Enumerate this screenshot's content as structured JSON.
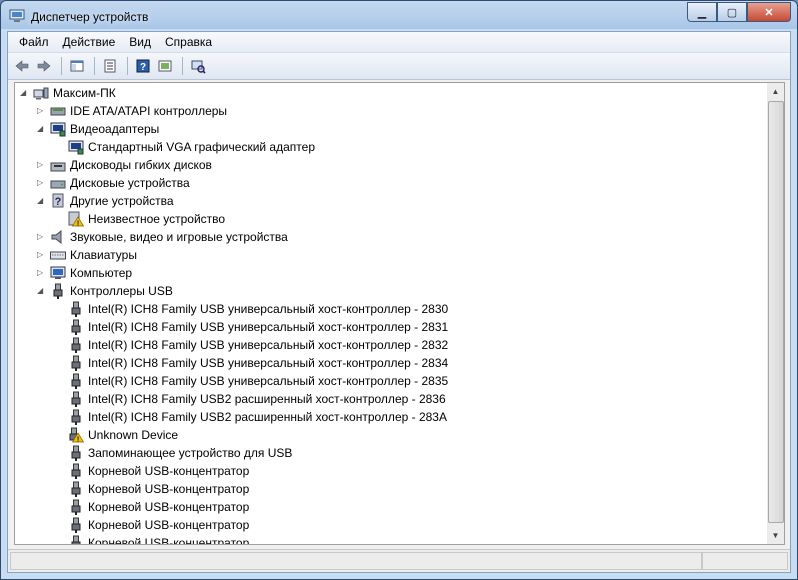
{
  "window": {
    "title": "Диспетчер устройств",
    "caption": {
      "minimize": "▁",
      "maximize": "▢",
      "close": "✕"
    }
  },
  "menu": [
    "Файл",
    "Действие",
    "Вид",
    "Справка"
  ],
  "toolbar": [
    "back-arrow-icon",
    "forward-arrow-icon",
    "sep",
    "console-tree-icon",
    "sep",
    "properties-icon",
    "sep",
    "help-icon",
    "show-hide-icon",
    "sep",
    "scan-hardware-icon"
  ],
  "tree": [
    {
      "label": "Максим-ПК",
      "level": 0,
      "expander": "open",
      "icon": "computer"
    },
    {
      "label": "IDE ATA/ATAPI контроллеры",
      "level": 1,
      "expander": "closed",
      "icon": "ide"
    },
    {
      "label": "Видеоадаптеры",
      "level": 1,
      "expander": "open",
      "icon": "display"
    },
    {
      "label": "Стандартный VGA графический адаптер",
      "level": 2,
      "expander": "none",
      "icon": "display"
    },
    {
      "label": "Дисководы гибких дисков",
      "level": 1,
      "expander": "closed",
      "icon": "floppy"
    },
    {
      "label": "Дисковые устройства",
      "level": 1,
      "expander": "closed",
      "icon": "disk"
    },
    {
      "label": "Другие устройства",
      "level": 1,
      "expander": "open",
      "icon": "unknown"
    },
    {
      "label": "Неизвестное устройство",
      "level": 2,
      "expander": "none",
      "icon": "warning"
    },
    {
      "label": "Звуковые, видео и игровые устройства",
      "level": 1,
      "expander": "closed",
      "icon": "sound"
    },
    {
      "label": "Клавиатуры",
      "level": 1,
      "expander": "closed",
      "icon": "keyboard"
    },
    {
      "label": "Компьютер",
      "level": 1,
      "expander": "closed",
      "icon": "monitor"
    },
    {
      "label": "Контроллеры USB",
      "level": 1,
      "expander": "open",
      "icon": "usb"
    },
    {
      "label": "Intel(R) ICH8 Family USB универсальный хост-контроллер  - 2830",
      "level": 2,
      "expander": "none",
      "icon": "usb"
    },
    {
      "label": "Intel(R) ICH8 Family USB универсальный хост-контроллер  - 2831",
      "level": 2,
      "expander": "none",
      "icon": "usb"
    },
    {
      "label": "Intel(R) ICH8 Family USB универсальный хост-контроллер  - 2832",
      "level": 2,
      "expander": "none",
      "icon": "usb"
    },
    {
      "label": "Intel(R) ICH8 Family USB универсальный хост-контроллер  - 2834",
      "level": 2,
      "expander": "none",
      "icon": "usb"
    },
    {
      "label": "Intel(R) ICH8 Family USB универсальный хост-контроллер  - 2835",
      "level": 2,
      "expander": "none",
      "icon": "usb"
    },
    {
      "label": "Intel(R) ICH8 Family USB2 расширенный хост-контроллер  - 2836",
      "level": 2,
      "expander": "none",
      "icon": "usb"
    },
    {
      "label": "Intel(R) ICH8 Family USB2 расширенный хост-контроллер  - 283A",
      "level": 2,
      "expander": "none",
      "icon": "usb"
    },
    {
      "label": "Unknown Device",
      "level": 2,
      "expander": "none",
      "icon": "usb-warning"
    },
    {
      "label": "Запоминающее устройство для USB",
      "level": 2,
      "expander": "none",
      "icon": "usb"
    },
    {
      "label": "Корневой USB-концентратор",
      "level": 2,
      "expander": "none",
      "icon": "usb"
    },
    {
      "label": "Корневой USB-концентратор",
      "level": 2,
      "expander": "none",
      "icon": "usb"
    },
    {
      "label": "Корневой USB-концентратор",
      "level": 2,
      "expander": "none",
      "icon": "usb"
    },
    {
      "label": "Корневой USB-концентратор",
      "level": 2,
      "expander": "none",
      "icon": "usb"
    },
    {
      "label": "Корневой USB-концентратор",
      "level": 2,
      "expander": "none",
      "icon": "usb"
    }
  ],
  "scrollbar": {
    "up": "▲",
    "down": "▼"
  },
  "colors": {
    "title_bar": "#a9c6e8",
    "warning": "#f2c200",
    "tree_bg": "#ffffff"
  }
}
